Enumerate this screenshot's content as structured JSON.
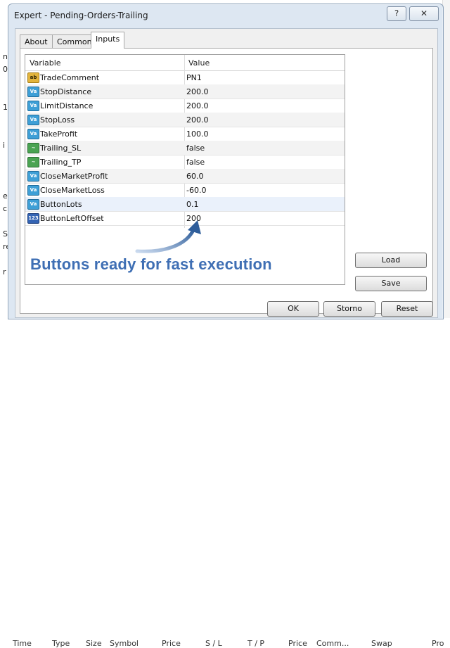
{
  "window": {
    "title": "Expert - Pending-Orders-Trailing",
    "help_label": "?",
    "close_label": "✕"
  },
  "tabs": [
    {
      "label": "About",
      "active": false
    },
    {
      "label": "Common",
      "active": false
    },
    {
      "label": "Inputs",
      "active": true
    }
  ],
  "grid": {
    "columns": [
      "Variable",
      "Value"
    ],
    "rows": [
      {
        "icon": "ab",
        "icon_name": "string-type-icon",
        "name": "TradeComment",
        "value": "PN1"
      },
      {
        "icon": "Va",
        "icon_name": "double-type-icon",
        "name": "StopDistance",
        "value": "200.0"
      },
      {
        "icon": "Va",
        "icon_name": "double-type-icon",
        "name": "LimitDistance",
        "value": "200.0"
      },
      {
        "icon": "Va",
        "icon_name": "double-type-icon",
        "name": "StopLoss",
        "value": "200.0"
      },
      {
        "icon": "Va",
        "icon_name": "double-type-icon",
        "name": "TakeProfit",
        "value": "100.0"
      },
      {
        "icon": "bool",
        "icon_name": "bool-type-icon",
        "name": "Trailing_SL",
        "value": "false"
      },
      {
        "icon": "bool",
        "icon_name": "bool-type-icon",
        "name": "Trailing_TP",
        "value": "false"
      },
      {
        "icon": "Va",
        "icon_name": "double-type-icon",
        "name": "CloseMarketProfit",
        "value": "60.0"
      },
      {
        "icon": "Va",
        "icon_name": "double-type-icon",
        "name": "CloseMarketLoss",
        "value": "-60.0"
      },
      {
        "icon": "Va",
        "icon_name": "double-type-icon",
        "name": "ButtonLots",
        "value": "0.1"
      },
      {
        "icon": "123",
        "icon_name": "integer-type-icon",
        "name": "ButtonLeftOffset",
        "value": "200"
      }
    ]
  },
  "annotation": {
    "text": "Buttons ready for fast execution",
    "color": "#3f6fb4"
  },
  "side_buttons": {
    "load": "Load",
    "save": "Save"
  },
  "footer_buttons": {
    "ok": "OK",
    "storno": "Storno",
    "reset": "Reset"
  },
  "background": {
    "left_fragments": [
      "n",
      "0",
      "1",
      "i",
      "e",
      "c",
      "S",
      "re",
      "r"
    ],
    "table_columns": [
      "Time",
      "Type",
      "Size",
      "Symbol",
      "Price",
      "S / L",
      "T / P",
      "Price",
      "Comm...",
      "Swap",
      "Pro"
    ]
  }
}
